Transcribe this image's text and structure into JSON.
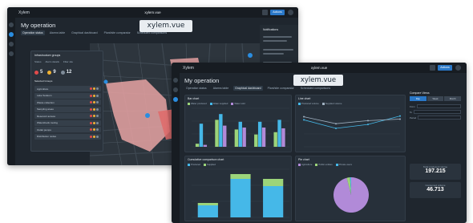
{
  "back_window": {
    "app_name": "Xylem",
    "brand": "xylem.vue",
    "hero_brand": "xylem.vue",
    "title": "My operation",
    "tabs": [
      "Operation status",
      "Alarms table",
      "Graphical dashboard",
      "Plant/site comparator",
      "Scheduled comparisons"
    ],
    "active_tab": 0,
    "top_button": "Actions",
    "panel": {
      "title": "Infrastructure groups",
      "subtabs": [
        "Status",
        "Alarm details",
        "Filter site"
      ],
      "counts": [
        {
          "value": "5",
          "color": "#e14b4b"
        },
        {
          "value": "9",
          "color": "#f0b233"
        },
        {
          "value": "12",
          "color": "#7f8c99"
        }
      ],
      "list_heading": "Selected Groups",
      "items": [
        "Agriculture",
        "Lake Sodeum",
        "Waste collection",
        "Sampling areas",
        "Reservoir access",
        "Watersheds routing",
        "Outlet pumps",
        "Distribution nodes"
      ]
    },
    "right_pane_heading": "Notifications"
  },
  "front_window": {
    "app_name": "Xylem",
    "brand": "xylem.vue",
    "hero_brand": "xylem.vue",
    "title": "My operation",
    "tabs": [
      "Operation status",
      "Alarms table",
      "Graphical dashboard",
      "Plant/site comparator",
      "Scheduled comparisons"
    ],
    "active_tab": 2,
    "top_button": "Actions",
    "kpi_1": {
      "label": "Total produced volume",
      "value": "197.215"
    },
    "kpi_2": {
      "label": "Consumed volume",
      "value": "46.713"
    },
    "controls": {
      "heading": "Compare Views",
      "toggle": [
        "Day",
        "Week",
        "Month"
      ],
      "rows": [
        "From",
        "To",
        "Period"
      ]
    }
  },
  "chart_data": [
    {
      "type": "bar",
      "title": "Bar chart",
      "categories": [
        "A",
        "B",
        "C",
        "D",
        "E"
      ],
      "series": [
        {
          "name": "Water produced",
          "values": [
            8,
            70,
            45,
            32,
            38
          ],
          "color": "#9cd47a"
        },
        {
          "name": "Water supplied",
          "values": [
            60,
            85,
            65,
            65,
            70
          ],
          "color": "#45b8e8"
        },
        {
          "name": "Water sold",
          "values": [
            5,
            55,
            50,
            50,
            48
          ],
          "color": "#b18ad8"
        }
      ],
      "ylim": [
        0,
        100
      ]
    },
    {
      "type": "line",
      "title": "Line chart",
      "x": [
        1,
        2,
        3,
        4
      ],
      "series": [
        {
          "name": "Produced volume",
          "values": [
            70,
            48,
            58,
            80
          ],
          "color": "#45b8e8"
        },
        {
          "name": "Supplied volume",
          "values": [
            78,
            60,
            68,
            72
          ],
          "color": "#9fb0c0"
        }
      ],
      "ylim": [
        0,
        100
      ]
    },
    {
      "type": "bar",
      "title": "Cumulative comparison chart",
      "categories": [
        "A",
        "B",
        "C"
      ],
      "series": [
        {
          "name": "Produced",
          "values": [
            25,
            80,
            65
          ],
          "color": "#45b8e8"
        },
        {
          "name": "Supplied",
          "values": [
            5,
            10,
            15
          ],
          "color": "#9cd47a"
        }
      ],
      "ylim": [
        0,
        100
      ]
    },
    {
      "type": "pie",
      "title": "Pie chart",
      "slices": [
        {
          "name": "Agriculture",
          "value": 96,
          "color": "#b18ad8"
        },
        {
          "name": "Public entities",
          "value": 3,
          "color": "#9cd47a"
        },
        {
          "name": "Private users",
          "value": 1,
          "color": "#45b8e8"
        }
      ]
    }
  ]
}
